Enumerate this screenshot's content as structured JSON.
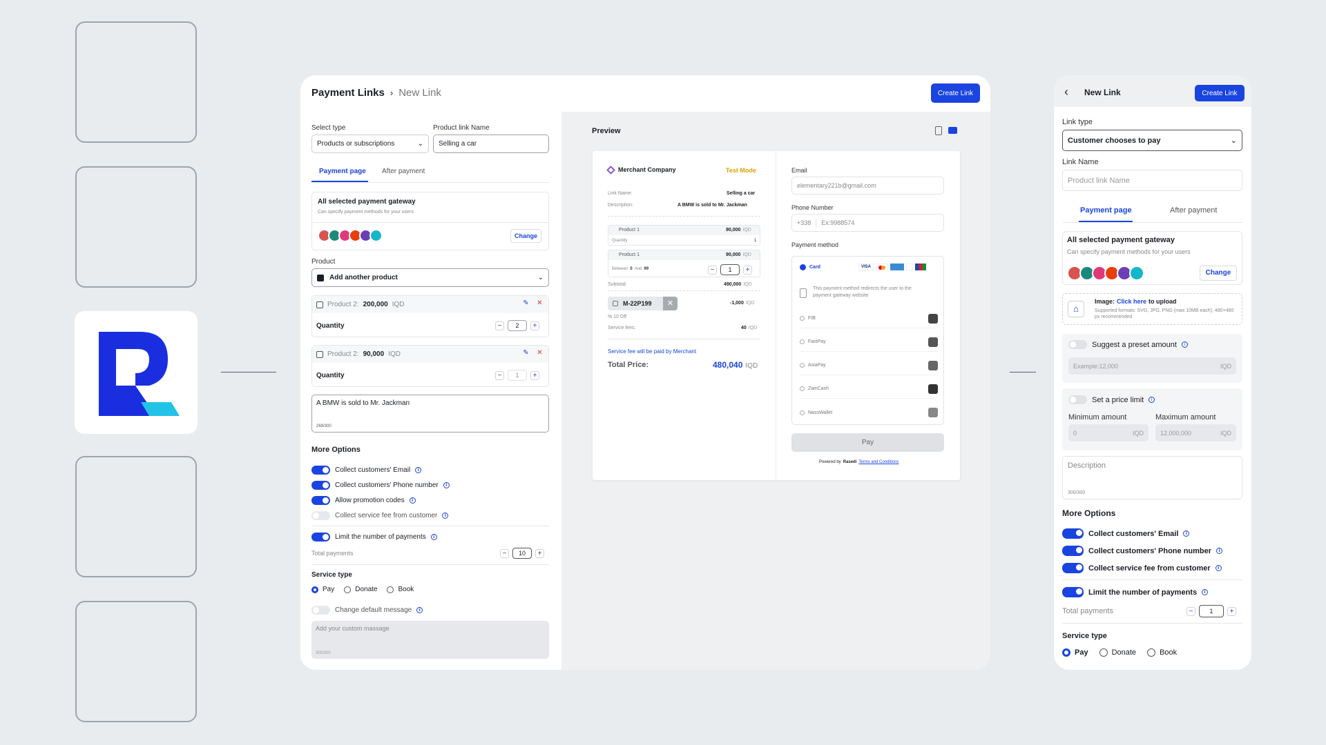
{
  "colors": {
    "accent": "#1a44e0",
    "test_mode": "#e0a000",
    "bg": "#e8ecef"
  },
  "main": {
    "breadcrumb_root": "Payment Links",
    "breadcrumb_current": "New Link",
    "create_button": "Create Link",
    "select_type_label": "Select type",
    "select_type_value": "Products or subscriptions",
    "product_link_name_label": "Product link Name",
    "product_link_name_value": "Selling a car",
    "tab_payment": "Payment page",
    "tab_after": "After payment",
    "gateway_title": "All selected payment gateway",
    "gateway_sub": "Can specify payment methods for your users",
    "change": "Change",
    "product_label": "Product",
    "add_product": "Add another product",
    "p1_name": "Product 2:",
    "p1_price": "200,000",
    "p1_cur": "IQD",
    "p1_qty_label": "Quantity",
    "p1_qty": "2",
    "p2_name": "Product 2:",
    "p2_price": "90,000",
    "p2_cur": "IQD",
    "p2_qty_label": "Quantity",
    "p2_qty": "1",
    "description": "A BMW is sold to Mr. Jackman",
    "desc_count": "269/300",
    "more_options": "More Options",
    "opt_email": "Collect customers' Email",
    "opt_phone": "Collect customers' Phone number",
    "opt_promo": "Allow promotion codes",
    "opt_fee": "Collect service fee from customer",
    "opt_limit": "Limit the number of payments",
    "total_payments": "Total payments",
    "total_value": "10",
    "service_type": "Service type",
    "st_pay": "Pay",
    "st_donate": "Donate",
    "st_book": "Book",
    "change_msg": "Change default message",
    "custom_msg_placeholder": "Add your custom massage",
    "custom_count": "300/300"
  },
  "preview": {
    "title": "Preview",
    "merchant": "Merchant Company",
    "test_mode": "Test Mode",
    "link_name_label": "Link Name:",
    "link_name_value": "Selling a car",
    "desc_label": "Description:",
    "desc_value": "A BMW is sold to Mr. Jackman",
    "prod1": "Product 1",
    "prod1_price": "90,000",
    "cur": "IQD",
    "qty_label": "Quantity",
    "qty_value": "1",
    "prod2": "Product 1",
    "prod2_price": "90,000",
    "between": "Between",
    "between_min": "0",
    "and": "And",
    "between_max": "99",
    "stepper_value": "1",
    "subtotal_label": "Subtotal:",
    "subtotal_value": "490,000",
    "coupon": "M-22P199",
    "coupon_value": "-1,000",
    "discount": "% 10  Off",
    "fees_label": "Service fees:",
    "fees_value": "40",
    "fee_note": "Service fee will be paid by Merchant",
    "total_label": "Total Price:",
    "total_value": "480,040",
    "email_label": "Email",
    "email_value": "elementary221b@gmail.com",
    "phone_label": "Phone Number",
    "phone_code": "+338",
    "phone_placeholder": "Ex:9988574",
    "pm_label": "Payment method",
    "card": "Card",
    "card_logos": [
      "VISA",
      "MC",
      "AMEX",
      "•",
      "JCB"
    ],
    "redirect_note": "This payment method redirects the user to the payment gateway website",
    "gateways": [
      "FIB",
      "FastPay",
      "AsiaPay",
      "ZainCash",
      "NassWallet"
    ],
    "pay": "Pay",
    "powered": "Powered by",
    "brand": "Rasedi",
    "terms": "Terms and Conditions"
  },
  "mobile": {
    "title": "New Link",
    "create_button": "Create Link",
    "link_type_label": "Link type",
    "link_type_value": "Customer chooses to pay",
    "link_name_label": "Link Name",
    "link_name_placeholder": "Product link Name",
    "tab_payment": "Payment page",
    "tab_after": "After payment",
    "gateway_title": "All selected payment gateway",
    "gateway_sub": "Can specify payment methods for your users",
    "change": "Change",
    "image_label": "Image:",
    "click_here": "Click here",
    "to_upload": "to upload",
    "image_hint": "Supported formats: SVG, JPG, PNG (max 10MB each), 480×480 px recommended",
    "preset_label": "Suggest a preset amount",
    "preset_placeholder": "Example:12,000",
    "cur": "IQD",
    "limit_label": "Set a price limit",
    "min_label": "Minimum amount",
    "min_value": "0",
    "max_label": "Maximum amount",
    "max_value": "12,000,000",
    "desc_placeholder": "Description",
    "desc_count": "300/300",
    "more_options": "More Options",
    "opt_email": "Collect customers' Email",
    "opt_phone": "Collect customers' Phone number",
    "opt_fee": "Collect service fee from customer",
    "opt_limit": "Limit the number of payments",
    "total_payments": "Total payments",
    "total_value": "1",
    "service_type": "Service type",
    "st_pay": "Pay",
    "st_donate": "Donate",
    "st_book": "Book"
  }
}
